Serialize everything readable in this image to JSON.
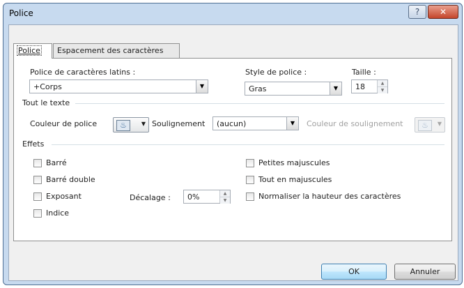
{
  "window": {
    "title": "Police",
    "help_label": "?",
    "close_label": "✕"
  },
  "tabs": [
    {
      "label": "Police",
      "active": true
    },
    {
      "label": "Espacement des caractères",
      "active": false
    }
  ],
  "font_section": {
    "latin_font_label": "Police de caractères latins :",
    "latin_font_value": "+Corps",
    "style_label": "Style de police :",
    "style_value": "Gras",
    "size_label": "Taille :",
    "size_value": "18"
  },
  "all_text": {
    "heading": "Tout le texte",
    "font_color_label": "Couleur de police",
    "underline_label": "Soulignement",
    "underline_value": "(aucun)",
    "underline_color_label": "Couleur de soulignement"
  },
  "effects": {
    "heading": "Effets",
    "left": [
      {
        "label": "Barré",
        "checked": false
      },
      {
        "label": "Barré double",
        "checked": false
      },
      {
        "label": "Exposant",
        "checked": false
      },
      {
        "label": "Indice",
        "checked": false
      }
    ],
    "right": [
      {
        "label": "Petites majuscules",
        "checked": false
      },
      {
        "label": "Tout en majuscules",
        "checked": false
      },
      {
        "label": "Normaliser la hauteur des caractères",
        "checked": false
      }
    ],
    "offset_label": "Décalage :",
    "offset_value": "0%"
  },
  "buttons": {
    "ok": "OK",
    "cancel": "Annuler"
  },
  "icons": {
    "dropdown": "chevron-down-icon",
    "spin": "spin-up-down-icon",
    "font_color": "paint-bucket-icon"
  },
  "colors": {
    "frame": "#c7daef",
    "client": "#f0f0f0",
    "close_button": "#c4452b",
    "default_button_border": "#3c7fb1"
  }
}
